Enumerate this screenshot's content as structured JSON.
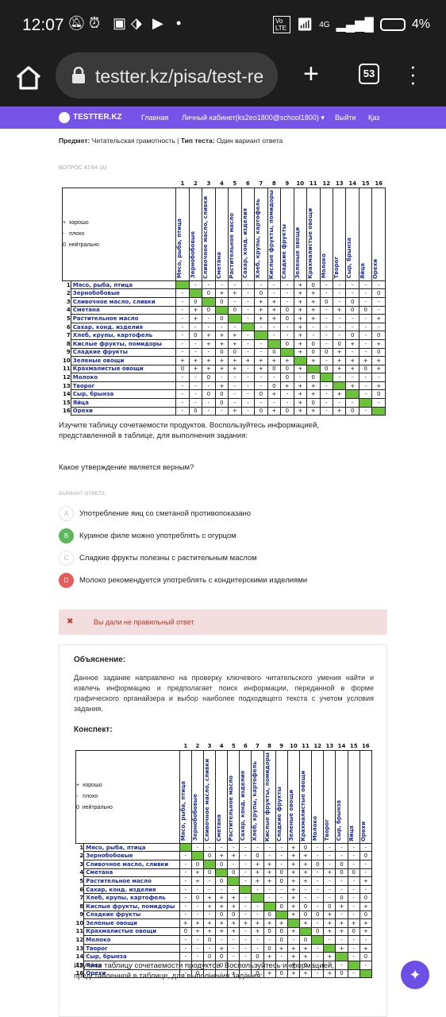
{
  "status_bar": {
    "time": "12:07",
    "dot": "•",
    "network": "4G",
    "battery": "4%",
    "lte": "Vo LTE"
  },
  "browser": {
    "url": "testter.kz/pisa/test-re",
    "tab_count": "53"
  },
  "site_nav": {
    "brand": "TESTTER.KZ",
    "links": [
      "Главная",
      "Личный кабинет(ks2eo1800@school1800) ▾",
      "Выйти",
      "Қаз"
    ]
  },
  "meta_line": {
    "subject_label": "Предмет:",
    "subject": "Читательская грамотность",
    "sep": "|",
    "type_label": "Тип теста:",
    "type": "Один вариант ответа"
  },
  "question_number": "ВОПРОС 41/84 (A)",
  "table": {
    "legend": [
      "+  хорошо",
      "-   плохо",
      "0  нейтрально"
    ],
    "col_numbers": [
      "1",
      "2",
      "3",
      "4",
      "5",
      "6",
      "7",
      "8",
      "9",
      "10",
      "11",
      "12",
      "13",
      "14",
      "15",
      "16"
    ],
    "headers": [
      "Мясо, рыба, птица",
      "Зернобобовые",
      "Сливочное масло, сливки",
      "Сметана",
      "Растительное масло",
      "Сахар, конд. изделия",
      "Хлеб, крупы, картофель",
      "Кислые фрукты, помидоры",
      "Сладкие фрукты",
      "Зеленые овощи",
      "Крахмалистые овощи",
      "Молоко",
      "Творог",
      "Сыр, брынза",
      "Яйца",
      "Орехи"
    ],
    "rows": [
      {
        "n": "1",
        "name": "Мясо, рыба, птица",
        "cells": [
          "",
          "-",
          "-",
          "-",
          "-",
          "-",
          "-",
          "-",
          "-",
          "+",
          "0",
          "-",
          "-",
          "-",
          "-",
          "-"
        ]
      },
      {
        "n": "2",
        "name": "Зернобобовые",
        "cells": [
          "-",
          "",
          "0",
          "+",
          "+",
          "-",
          "0",
          "-",
          "-",
          "+",
          "+",
          "-",
          "-",
          "-",
          "-",
          "0"
        ]
      },
      {
        "n": "3",
        "name": "Сливочное масло, сливки",
        "cells": [
          "-",
          "0",
          "",
          "0",
          "-",
          "-",
          "+",
          "+",
          "-",
          "+",
          "+",
          "0",
          "-",
          "0",
          "-",
          "-"
        ]
      },
      {
        "n": "4",
        "name": "Сметана",
        "cells": [
          "-",
          "+",
          "0",
          "",
          "0",
          "-",
          "+",
          "+",
          "0",
          "+",
          "+",
          "-",
          "+",
          "0",
          "0",
          "-"
        ]
      },
      {
        "n": "5",
        "name": "Растительное масло",
        "cells": [
          "-",
          "+",
          "-",
          "0",
          "",
          "-",
          "+",
          "+",
          "0",
          "+",
          "+",
          "-",
          "-",
          "-",
          "-",
          "+"
        ]
      },
      {
        "n": "6",
        "name": "Сахар, конд. изделия",
        "cells": [
          "-",
          "-",
          "-",
          "-",
          "-",
          "",
          "-",
          "-",
          "-",
          "+",
          "-",
          "-",
          "-",
          "-",
          "-",
          "-"
        ]
      },
      {
        "n": "7",
        "name": "Хлеб, крупы, картофель",
        "cells": [
          "-",
          "0",
          "+",
          "+",
          "+",
          "-",
          "",
          "-",
          "-",
          "+",
          "-",
          "-",
          "-",
          "0",
          "-",
          "0"
        ]
      },
      {
        "n": "8",
        "name": "Кислые фрукты, помидоры",
        "cells": [
          "-",
          "-",
          "+",
          "+",
          "+",
          "-",
          "-",
          "",
          "0",
          "+",
          "0",
          "-",
          "0",
          "+",
          "-",
          "+"
        ]
      },
      {
        "n": "9",
        "name": "Сладкие фрукты",
        "cells": [
          "-",
          "-",
          "-",
          "0",
          "0",
          "-",
          "-",
          "0",
          "",
          "+",
          "0",
          "0",
          "+",
          "-",
          "-",
          "0"
        ]
      },
      {
        "n": "10",
        "name": "Зеленые овощи",
        "cells": [
          "+",
          "+",
          "+",
          "+",
          "+",
          "+",
          "+",
          "+",
          "+",
          "",
          "+",
          "-",
          "+",
          "+",
          "+",
          "+"
        ]
      },
      {
        "n": "11",
        "name": "Крахмалистые овощи",
        "cells": [
          "0",
          "+",
          "+",
          "+",
          "+",
          "-",
          "+",
          "0",
          "0",
          "+",
          "",
          "0",
          "+",
          "+",
          "0",
          "+"
        ]
      },
      {
        "n": "12",
        "name": "Молоко",
        "cells": [
          "-",
          "-",
          "0",
          "-",
          "-",
          "-",
          "-",
          "-",
          "0",
          "-",
          "0",
          "",
          "-",
          "-",
          "-",
          "-"
        ]
      },
      {
        "n": "13",
        "name": "Творог",
        "cells": [
          "-",
          "-",
          "-",
          "+",
          "-",
          "-",
          "-",
          "0",
          "+",
          "+",
          "+",
          "-",
          "",
          "+",
          "-",
          "+"
        ]
      },
      {
        "n": "14",
        "name": "Сыр, брынза",
        "cells": [
          "-",
          "-",
          "0",
          "0",
          "-",
          "-",
          "0",
          "+",
          "-",
          "+",
          "+",
          "-",
          "+",
          "",
          "-",
          "0"
        ]
      },
      {
        "n": "15",
        "name": "Яйца",
        "cells": [
          "-",
          "-",
          "-",
          "0",
          "-",
          "-",
          "-",
          "-",
          "-",
          "+",
          "0",
          "-",
          "-",
          "-",
          "",
          "-"
        ]
      },
      {
        "n": "16",
        "name": "Орехи",
        "cells": [
          "-",
          "0",
          "-",
          "-",
          "+",
          "-",
          "0",
          "+",
          "0",
          "+",
          "+",
          "-",
          "+",
          "0",
          "-",
          ""
        ]
      }
    ]
  },
  "instruction": "Изучите таблицу сочетаемости продуктов. Воспользуйтесь информацией, представленной в таблице, для выполнения задания:",
  "question": "Какое утверждение является верным?",
  "options_label": "ВАРИАНТ ОТВЕТА",
  "options": [
    {
      "letter": "A",
      "text": "Употребление яиц со сметаной противопоказано",
      "state": "none",
      "color": "#ffffff"
    },
    {
      "letter": "B",
      "text": "Куриное филе можно употреблять с огурцом",
      "state": "correct",
      "color": "#5cb85c"
    },
    {
      "letter": "C",
      "text": "Сладкие фрукты полезны с растительным маслом",
      "state": "none",
      "color": "#ffffff"
    },
    {
      "letter": "D",
      "text": "Молоко рекомендуется употреблять с кондитерскими изделиями",
      "state": "wrong",
      "color": "#e85b5b"
    }
  ],
  "alert": {
    "icon": "✖",
    "text": "Вы дали не правильный ответ"
  },
  "explanation": {
    "title": "Объяснение:",
    "text": "Данное задание направлено на проверку ключевого читательского умения найти и извлечь информацию и предполагает поиск информации, переданной в форме графического органайзера и выбор наиболее подходящего текста с учетом условия задания.",
    "konspekt": "Конспект:",
    "instruction2": "Изучите таблицу сочетаемости продуктов. Воспользуйтесь информацией, представленной в таблице, для выполнения задания:"
  },
  "colors": {
    "brand": "#7654e8",
    "green": "#6cc33a",
    "alert_bg": "#f2dede",
    "alert_text": "#c0392b"
  }
}
